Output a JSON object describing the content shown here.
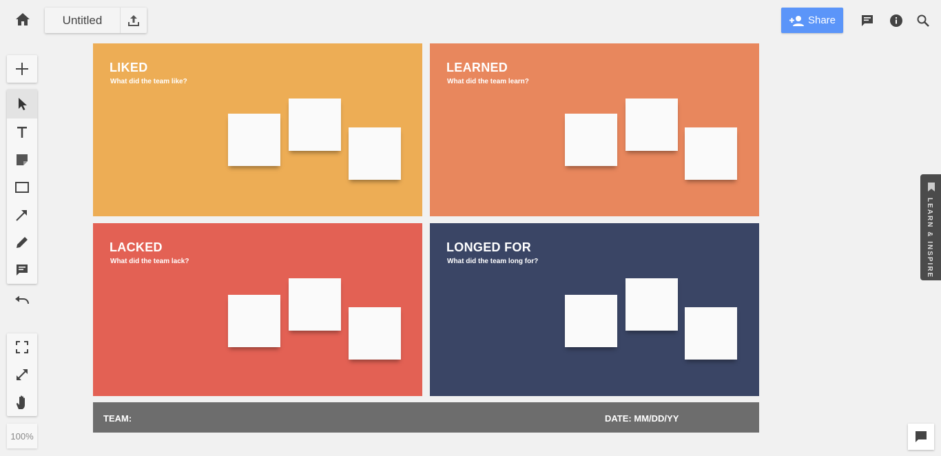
{
  "topbar": {
    "title": "Untitled",
    "share_label": "Share",
    "share_color": "#5b95f9"
  },
  "toolbar": {
    "zoom": "100%"
  },
  "board": {
    "quadrants": [
      {
        "title": "LIKED",
        "subtitle": "What did the team like?",
        "color": "#edad55"
      },
      {
        "title": "LEARNED",
        "subtitle": "What did the team learn?",
        "color": "#e8875d"
      },
      {
        "title": "LACKED",
        "subtitle": "What did the team lack?",
        "color": "#e36154"
      },
      {
        "title": "LONGED FOR",
        "subtitle": "What did the team long for?",
        "color": "#3a4565"
      }
    ],
    "footer": {
      "team_label": "TEAM:",
      "date_label": "DATE: MM/DD/YY",
      "color": "#6d6d6d"
    }
  },
  "side_tab": {
    "label": "LEARN & INSPIRE"
  }
}
